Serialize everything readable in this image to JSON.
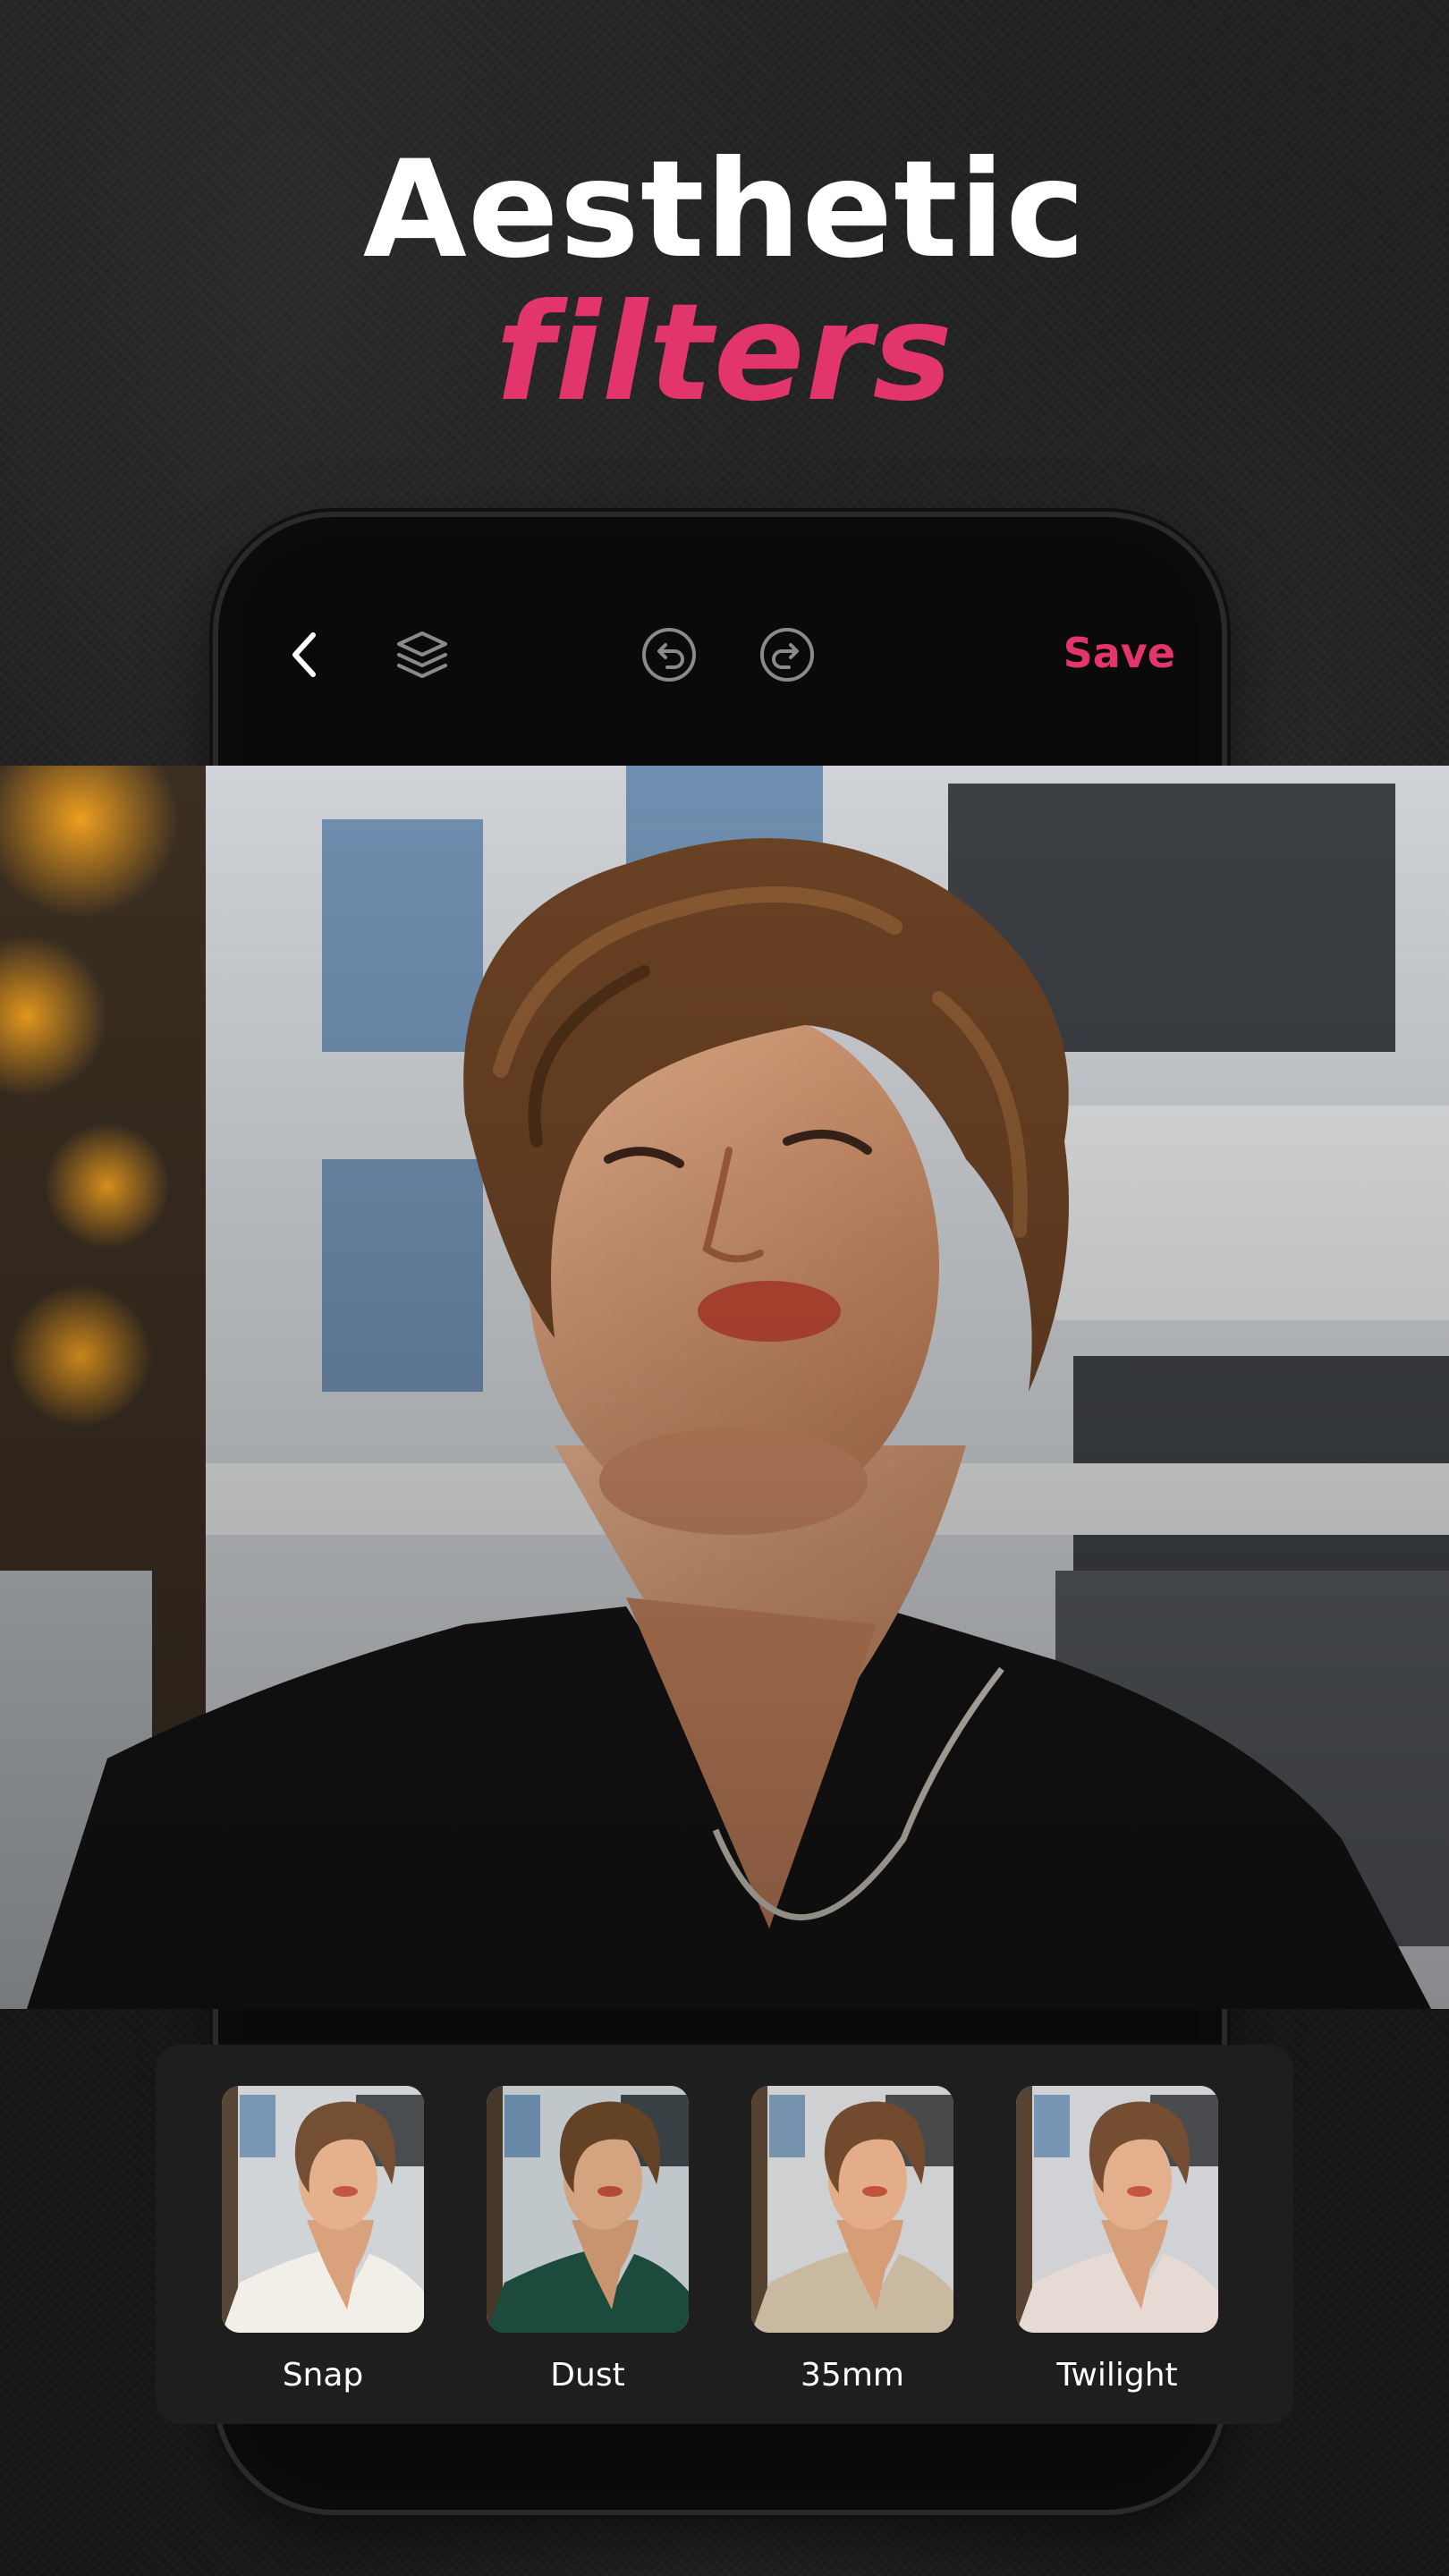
{
  "headline": {
    "line1": "Aesthetic",
    "line2": "filters"
  },
  "colors": {
    "accent": "#e2356b",
    "background": "#151515",
    "panel": "#1e1e1f",
    "text": "#ffffff",
    "icon": "#8a8a8a"
  },
  "toolbar": {
    "back_icon": "chevron-left-icon",
    "layers_icon": "layers-icon",
    "undo_icon": "undo-icon",
    "redo_icon": "redo-icon",
    "save_label": "Save"
  },
  "filters": [
    {
      "label": "Snap",
      "tint": "#f1efe8"
    },
    {
      "label": "Dust",
      "tint": "#1d4a3c"
    },
    {
      "label": "35mm",
      "tint": "#c9b9a0"
    },
    {
      "label": "Twilight",
      "tint": "#e8d9d4"
    }
  ]
}
